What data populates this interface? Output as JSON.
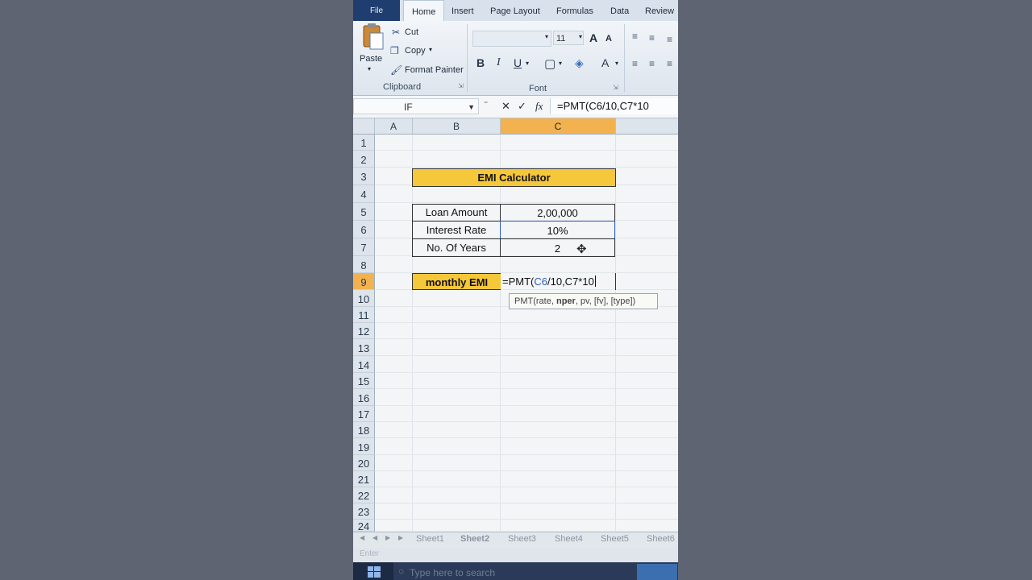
{
  "ribbon": {
    "tabs": [
      "File",
      "Home",
      "Insert",
      "Page Layout",
      "Formulas",
      "Data",
      "Review"
    ],
    "clipboard": {
      "paste": "Paste",
      "cut": "Cut",
      "copy": "Copy",
      "format_painter": "Format Painter",
      "group_label": "Clipboard"
    },
    "font": {
      "size": "11",
      "bold": "B",
      "italic": "I",
      "underline": "U",
      "grow": "A",
      "shrink": "A",
      "font_color": "A",
      "group_label": "Font"
    }
  },
  "formula_bar": {
    "name_box": "IF",
    "cancel": "✕",
    "enter": "✓",
    "fx": "fx",
    "formula": "=PMT(C6/10,C7*10"
  },
  "columns": [
    "A",
    "B",
    "C"
  ],
  "rows": [
    "1",
    "2",
    "3",
    "4",
    "5",
    "6",
    "7",
    "8",
    "9",
    "10",
    "11",
    "12",
    "13",
    "14",
    "15",
    "16",
    "17",
    "18",
    "19",
    "20",
    "21",
    "22",
    "23",
    "24"
  ],
  "sheet": {
    "title": "EMI Calculator",
    "loan_label": "Loan Amount",
    "loan_value": "2,00,000",
    "rate_label": "Interest Rate",
    "rate_value": "10%",
    "years_label": "No. Of Years",
    "years_value": "2",
    "emi_label": "monthly EMI",
    "emi_formula_prefix": "=PMT(",
    "emi_formula_ref": "C6",
    "emi_formula_suffix": "/10,C7*10"
  },
  "tooltip": {
    "fn": "PMT(",
    "arg1": "rate, ",
    "arg2": "nper",
    "rest": ", pv, [fv], [type])"
  },
  "sheet_tabs": [
    "Sheet1",
    "Sheet2",
    "Sheet3",
    "Sheet4",
    "Sheet5",
    "Sheet6"
  ],
  "status": "Enter",
  "taskbar": {
    "search": "Type here to search"
  }
}
